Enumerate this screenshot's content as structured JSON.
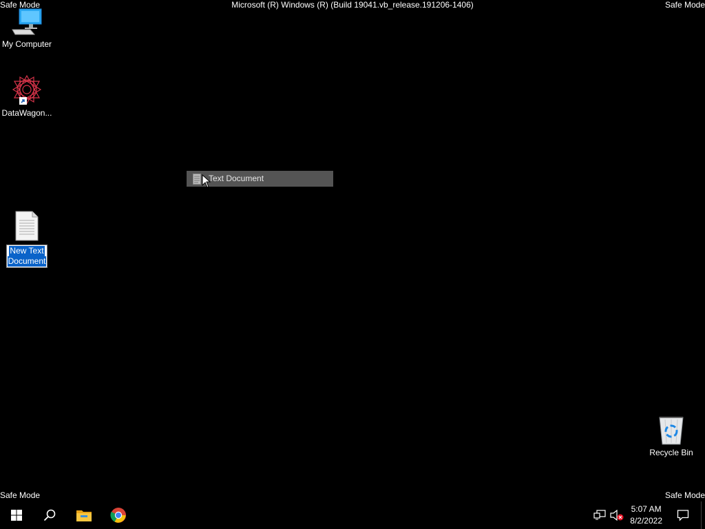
{
  "overlay": {
    "top_left": "Safe Mode",
    "top_center": "Microsoft (R) Windows (R) (Build 19041.vb_release.191206-1406)",
    "top_right": "Safe Mode",
    "bottom_left": "Safe Mode",
    "bottom_right": "Safe Mode"
  },
  "desktop": {
    "icons": [
      {
        "label": "My Computer",
        "icon": "computer-icon"
      },
      {
        "label": "DataWagon...",
        "icon": "datawagon-shortcut-icon"
      },
      {
        "label_line1": "New Text",
        "label_line2": "Document",
        "icon": "text-document-icon",
        "state": "renaming"
      },
      {
        "label": "Recycle Bin",
        "icon": "recycle-bin-icon"
      }
    ]
  },
  "drag": {
    "label": "Text Document"
  },
  "taskbar": {
    "buttons": [
      "start-icon",
      "search-icon",
      "file-explorer-icon",
      "chrome-icon"
    ],
    "tray": [
      "network-icon",
      "volume-muted-icon"
    ],
    "time": "5:07 AM",
    "date": "8/2/2022",
    "notification": "action-center-icon"
  }
}
